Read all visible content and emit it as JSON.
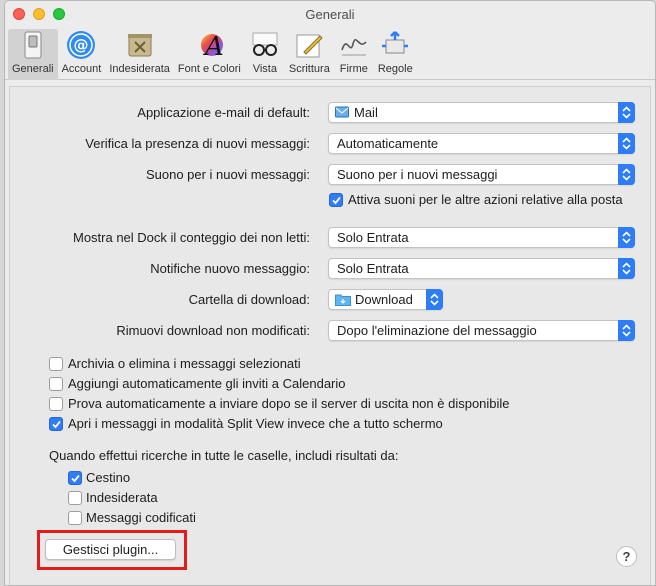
{
  "window": {
    "title": "Generali"
  },
  "toolbar": {
    "items": [
      {
        "label": "Generali",
        "icon": "switch-icon"
      },
      {
        "label": "Account",
        "icon": "at-sign-icon"
      },
      {
        "label": "Indesiderata",
        "icon": "junk-bin-icon"
      },
      {
        "label": "Font e Colori",
        "icon": "font-color-icon"
      },
      {
        "label": "Vista",
        "icon": "glasses-icon"
      },
      {
        "label": "Scrittura",
        "icon": "compose-icon"
      },
      {
        "label": "Firme",
        "icon": "signature-icon"
      },
      {
        "label": "Regole",
        "icon": "rules-icon"
      }
    ],
    "active": "Generali"
  },
  "settings": {
    "default_mail": {
      "label": "Applicazione e-mail di default:",
      "value": "Mail"
    },
    "check_new": {
      "label": "Verifica la presenza di nuovi messaggi:",
      "value": "Automaticamente"
    },
    "new_sound": {
      "label": "Suono per i nuovi messaggi:",
      "value": "Suono per i nuovi messaggi"
    },
    "other_sounds": {
      "label": "Attiva suoni per le altre azioni relative alla posta",
      "checked": true
    },
    "dock_count": {
      "label": "Mostra nel Dock il conteggio dei non letti:",
      "value": "Solo Entrata"
    },
    "notifications": {
      "label": "Notifiche nuovo messaggio:",
      "value": "Solo Entrata"
    },
    "download_folder": {
      "label": "Cartella di download:",
      "value": "Download"
    },
    "remove_downloads": {
      "label": "Rimuovi download non modificati:",
      "value": "Dopo l'eliminazione del messaggio"
    }
  },
  "checkboxes": [
    {
      "label": "Archivia o elimina i messaggi selezionati",
      "checked": false
    },
    {
      "label": "Aggiungi automaticamente gli inviti a Calendario",
      "checked": false
    },
    {
      "label": "Prova automaticamente a inviare dopo se il server di uscita non è disponibile",
      "checked": false
    },
    {
      "label": "Apri i messaggi in modalità Split View invece che a tutto schermo",
      "checked": true
    }
  ],
  "search": {
    "heading": "Quando effettui ricerche in tutte le caselle, includi risultati da:",
    "options": [
      {
        "label": "Cestino",
        "checked": true
      },
      {
        "label": "Indesiderata",
        "checked": false
      },
      {
        "label": "Messaggi codificati",
        "checked": false
      }
    ]
  },
  "buttons": {
    "plugin": "Gestisci plugin...",
    "help": "?"
  },
  "colors": {
    "accent": "#2e7cf6",
    "highlight": "#e21b1b"
  }
}
